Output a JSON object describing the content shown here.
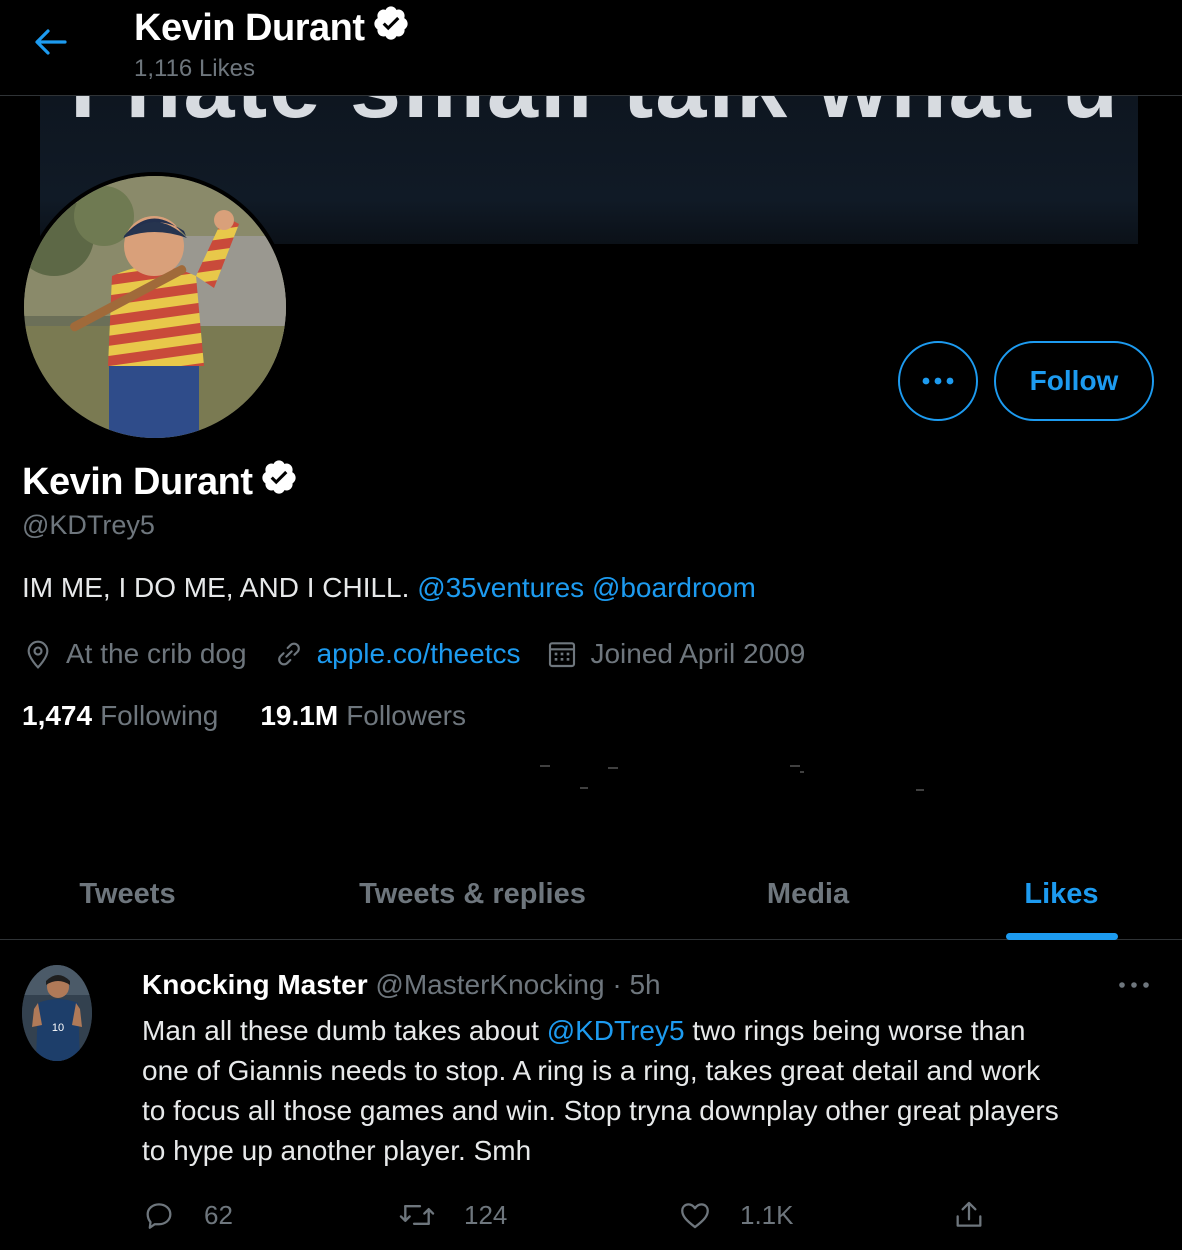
{
  "header": {
    "back_icon": "arrow-left-icon",
    "title": "Kevin Durant",
    "subtitle": "1,116 Likes"
  },
  "banner": {
    "text": "I hate small talk what u want"
  },
  "profile": {
    "name": "Kevin Durant",
    "handle": "@KDTrey5",
    "bio_text": "IM ME, I DO ME, AND I CHILL.",
    "bio_links": [
      "@35ventures",
      "@boardroom"
    ],
    "location": "At the crib dog",
    "website": "apple.co/theetcs",
    "joined": "Joined April 2009",
    "following_count": "1,474",
    "following_label": "Following",
    "followers_count": "19.1M",
    "followers_label": "Followers"
  },
  "actions": {
    "more_icon": "more-horizontal-icon",
    "follow_label": "Follow"
  },
  "tabs": [
    {
      "label": "Tweets",
      "active": false
    },
    {
      "label": "Tweets & replies",
      "active": false
    },
    {
      "label": "Media",
      "active": false
    },
    {
      "label": "Likes",
      "active": true
    }
  ],
  "tweet": {
    "author": "Knocking Master",
    "handle": "@MasterKnocking",
    "separator": " · ",
    "time": "5h",
    "avatar_text": "10",
    "lines": [
      {
        "pre": "Man all these dumb takes about ",
        "mention": "@KDTrey5",
        "post": " two rings being worse than"
      },
      {
        "text": "one of Giannis needs to stop. A ring is a ring, takes great detail and work"
      },
      {
        "text": "to focus all those games and win. Stop tryna downplay other great players"
      },
      {
        "text": "to hype up another player. Smh"
      }
    ],
    "reply_count": "62",
    "retweet_count": "124",
    "like_count": "1.1K"
  },
  "colors": {
    "accent": "#1d9bf0",
    "muted": "#6e767d",
    "background": "#000000",
    "border": "#2f3336"
  }
}
